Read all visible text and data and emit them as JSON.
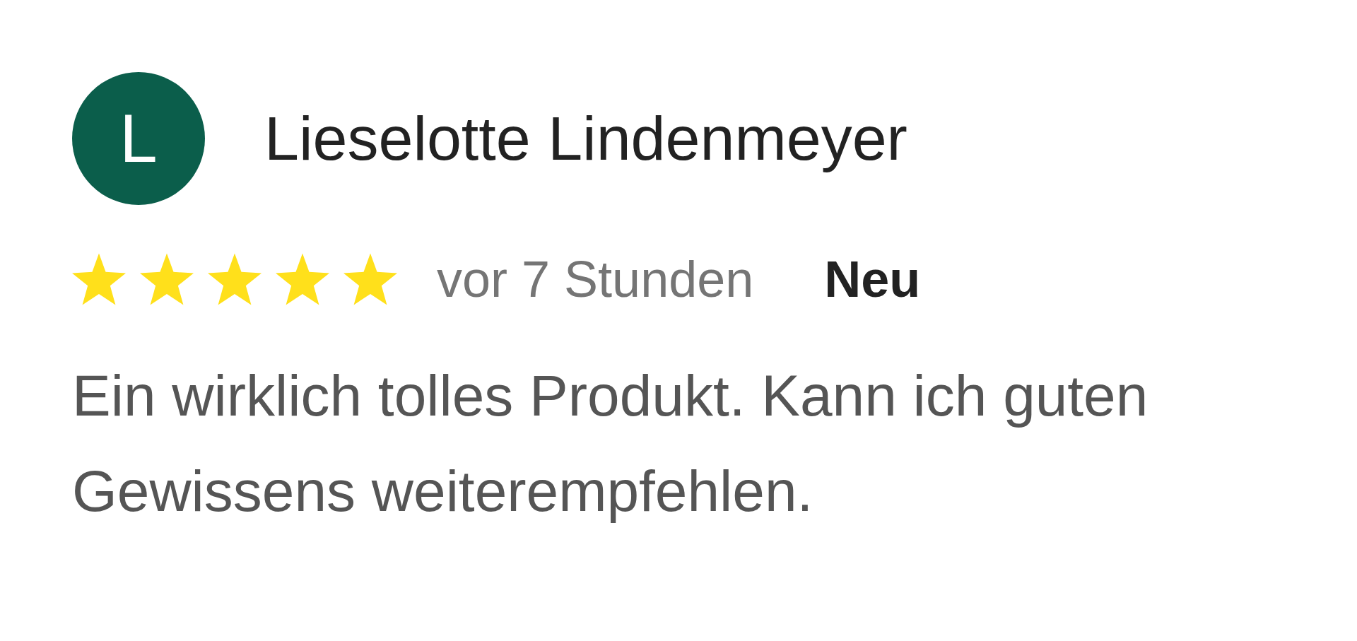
{
  "review": {
    "avatar_initial": "L",
    "author": "Lieselotte Lindenmeyer",
    "stars": 5,
    "time": "vor 7 Stunden",
    "badge": "Neu",
    "text": "Ein wirklich tolles Produkt. Kann ich guten Gewissens weiterempfehlen."
  }
}
